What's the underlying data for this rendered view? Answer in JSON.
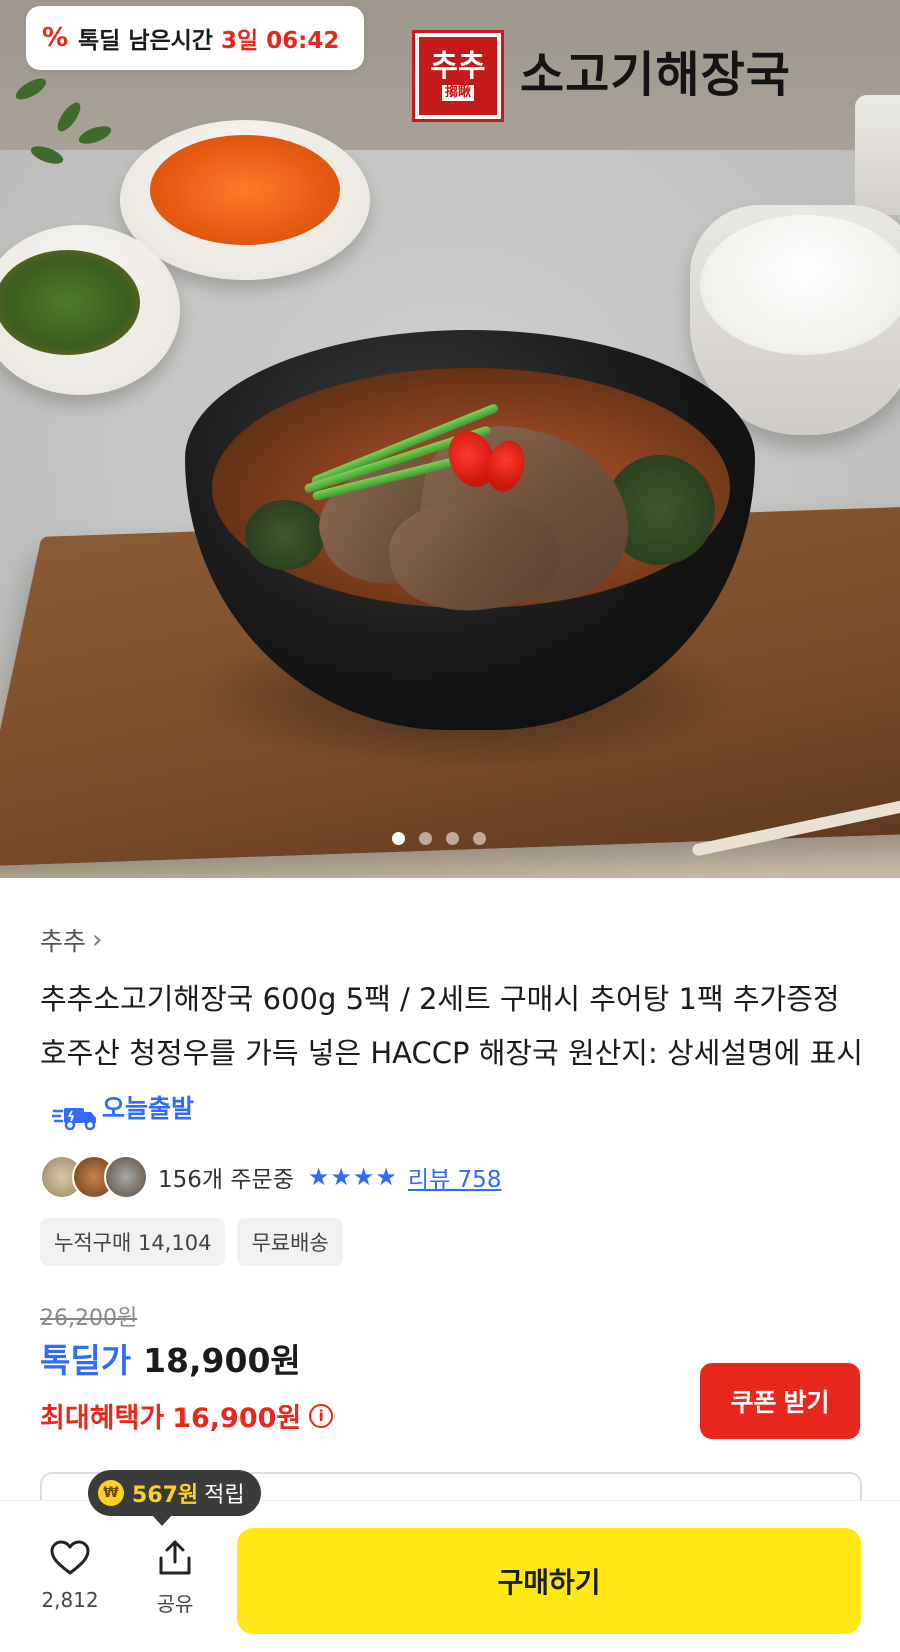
{
  "hero": {
    "timer_label": "톡딜 남은시간",
    "timer_value": "3일 06:42",
    "brand_logo_text": "추추",
    "brand_logo_sub": "搊瞅",
    "brand_title": "소고기해장국",
    "carousel_count": 4,
    "carousel_active_index": 0
  },
  "product": {
    "seller": "추추",
    "title": "추추소고기해장국 600g 5팩 / 2세트 구매시 추어탕 1팩 추가증정 호주산 청정우를 가득 넣은 HACCP 해장국 원산지: 상세설명에 표시",
    "today_ship_label": "오늘출발",
    "orders_text": "156개 주문중",
    "rating_stars": 4,
    "review_label": "리뷰 758",
    "chips": [
      "누적구매 14,104",
      "무료배송"
    ]
  },
  "price": {
    "original": "26,200원",
    "deal_label": "톡딜가",
    "deal_price": "18,900원",
    "max_label": "최대혜택가",
    "max_price": "16,900원",
    "coupon_button": "쿠폰 받기"
  },
  "points_tip": {
    "coin_icon": "coin-icon",
    "amount": "567원",
    "word": "적립"
  },
  "bottom": {
    "like_count": "2,812",
    "share_label": "공유",
    "buy_label": "구매하기"
  },
  "colors": {
    "accent_blue": "#2f6bff",
    "accent_red": "#e8261b",
    "buy_yellow": "#ffe812"
  }
}
